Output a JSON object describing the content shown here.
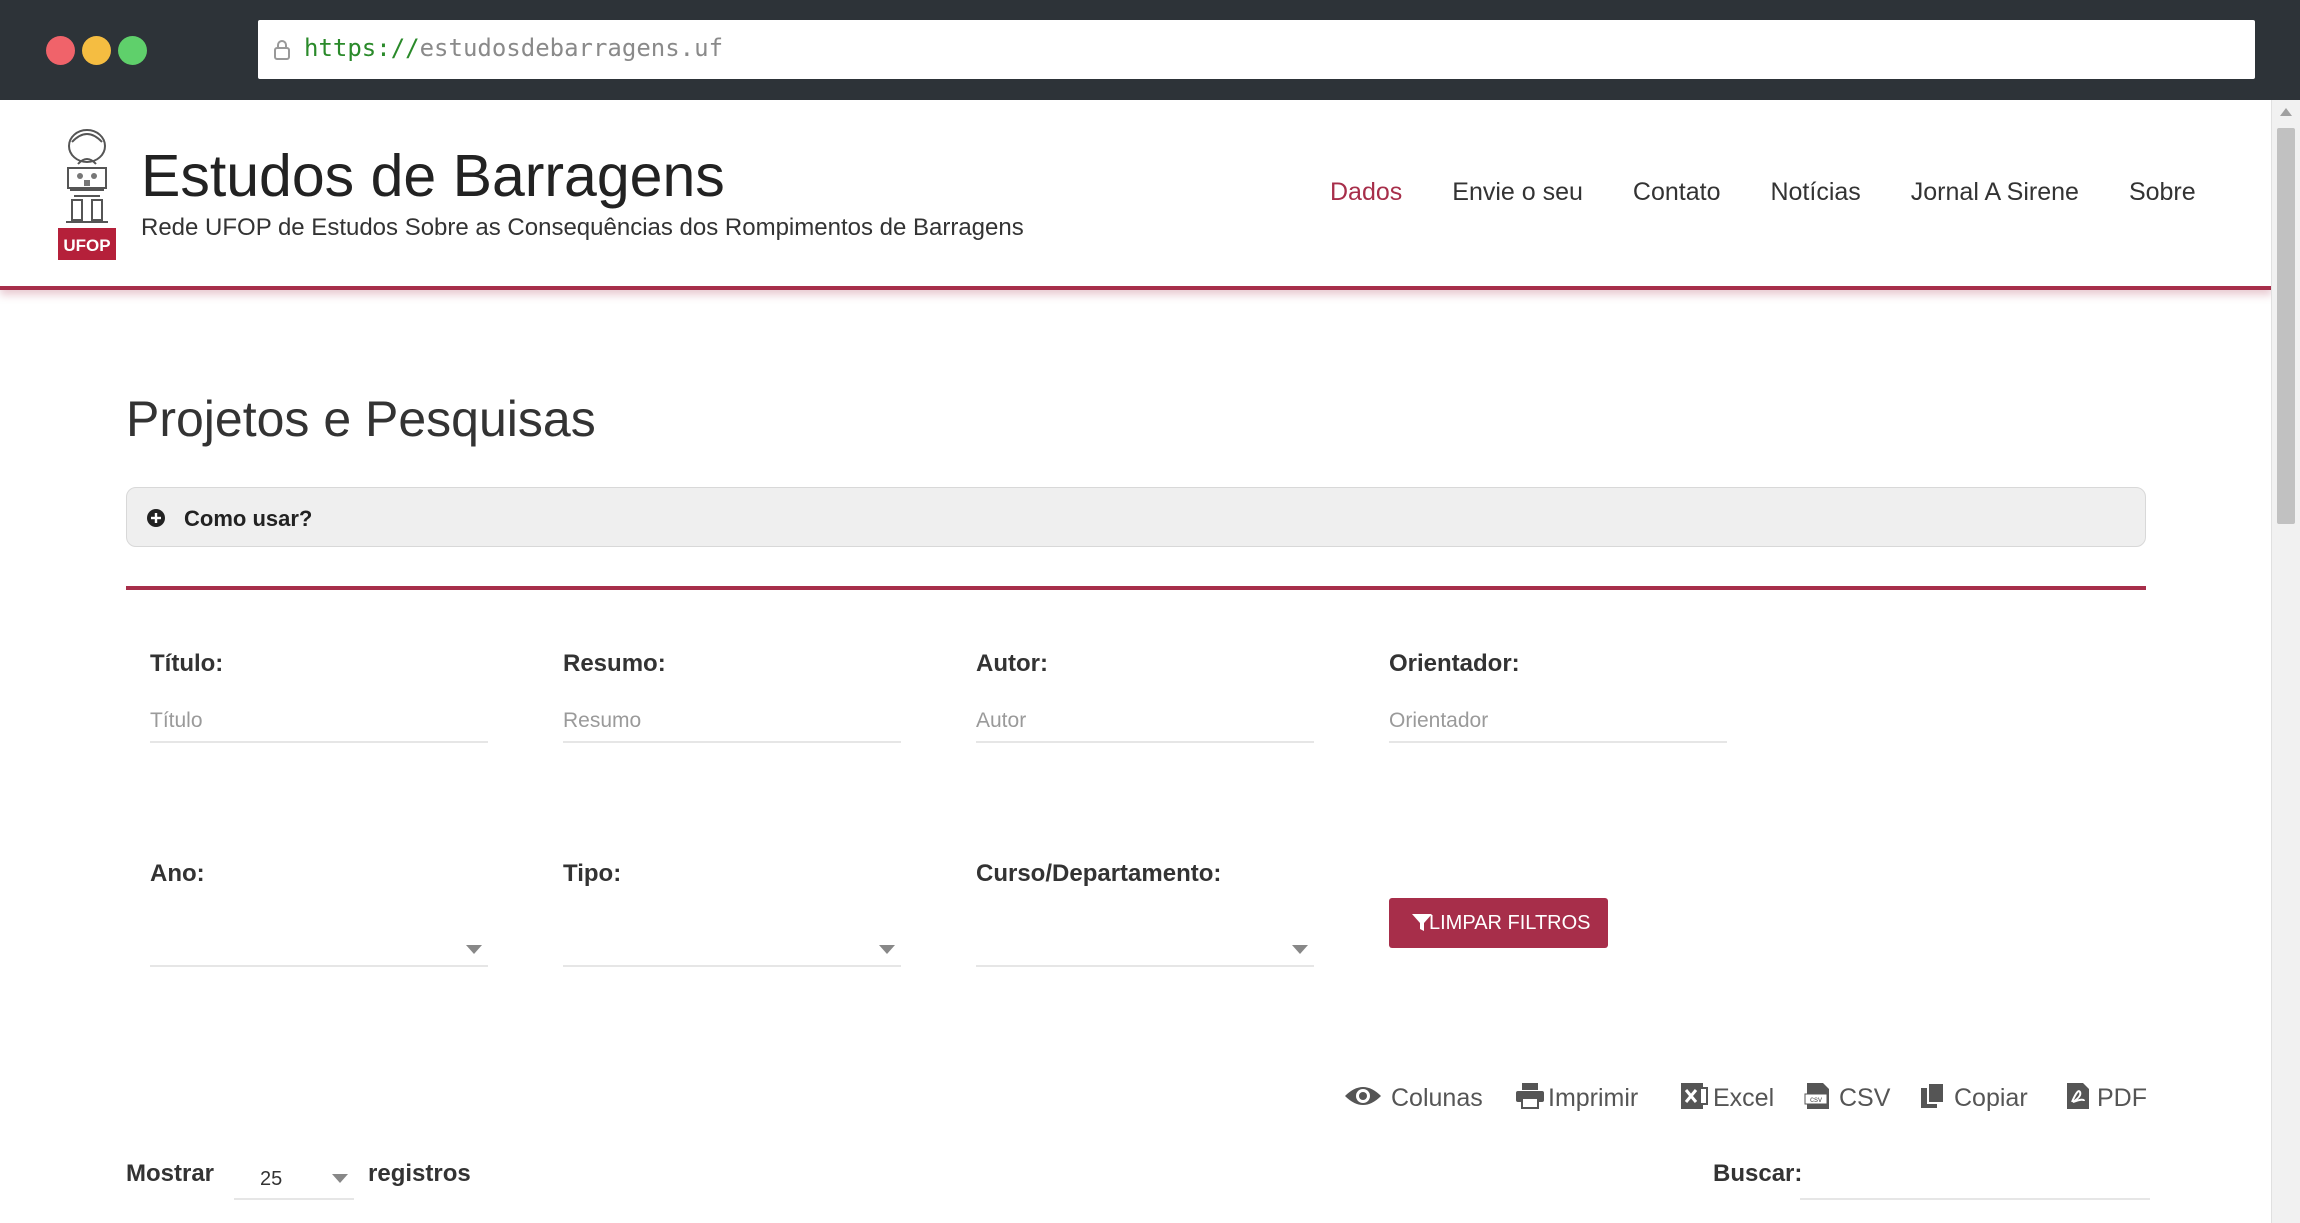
{
  "browser": {
    "url_scheme": "https://",
    "url_rest": "estudosdebarragens.uf"
  },
  "header": {
    "logo_text": "UFOP",
    "title": "Estudos de Barragens",
    "subtitle": "Rede UFOP de Estudos Sobre as Consequências dos Rompimentos de Barragens",
    "nav": [
      "Dados",
      "Envie o seu",
      "Contato",
      "Notícias",
      "Jornal A Sirene",
      "Sobre"
    ],
    "active_nav": "Dados"
  },
  "page": {
    "title": "Projetos e Pesquisas",
    "accordion_label": "Como usar?"
  },
  "filters": {
    "titulo_label": "Título:",
    "titulo_placeholder": "Título",
    "resumo_label": "Resumo:",
    "resumo_placeholder": "Resumo",
    "autor_label": "Autor:",
    "autor_placeholder": "Autor",
    "orientador_label": "Orientador:",
    "orientador_placeholder": "Orientador",
    "ano_label": "Ano:",
    "tipo_label": "Tipo:",
    "curso_label": "Curso/Departamento:",
    "clear_button": "LIMPAR FILTROS"
  },
  "toolbar": {
    "colunas": "Colunas",
    "imprimir": "Imprimir",
    "excel": "Excel",
    "csv": "CSV",
    "copiar": "Copiar",
    "pdf": "PDF"
  },
  "table_controls": {
    "show_label": "Mostrar",
    "page_length": "25",
    "records_label": "registros",
    "search_label": "Buscar:"
  },
  "colors": {
    "accent": "#a72e4a",
    "chrome": "#2d3338"
  }
}
